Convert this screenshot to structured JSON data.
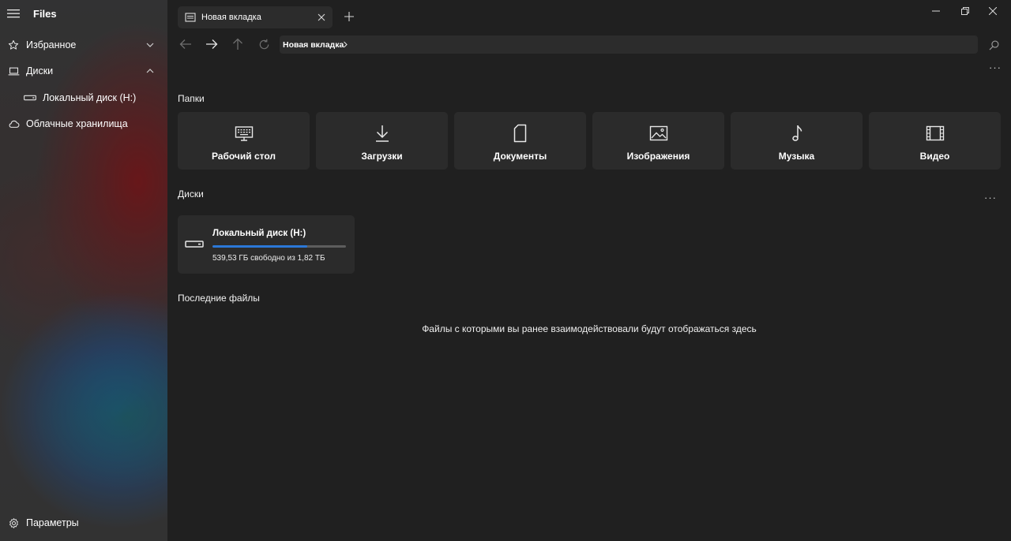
{
  "app": {
    "title": "Files"
  },
  "sidebar": {
    "favorites_label": "Избранное",
    "drives_label": "Диски",
    "local_disk_label": "Локальный диск (H:)",
    "cloud_label": "Облачные хранилища",
    "settings_label": "Параметры"
  },
  "tabs": [
    {
      "label": "Новая вкладка"
    }
  ],
  "address": {
    "crumb": "Новая вкладка"
  },
  "sections": {
    "folders": "Папки",
    "drives": "Диски",
    "recent": "Последние файлы"
  },
  "folders": [
    {
      "label": "Рабочий стол",
      "icon": "desktop-icon"
    },
    {
      "label": "Загрузки",
      "icon": "download-icon"
    },
    {
      "label": "Документы",
      "icon": "document-icon"
    },
    {
      "label": "Изображения",
      "icon": "image-icon"
    },
    {
      "label": "Музыка",
      "icon": "music-icon"
    },
    {
      "label": "Видео",
      "icon": "video-icon"
    }
  ],
  "drives": [
    {
      "name": "Локальный диск (H:)",
      "space_text": "539,53 ГБ свободно из 1,82 ТБ",
      "used_fraction": 0.71
    }
  ],
  "recent": {
    "empty_text": "Файлы с которыми вы ранее взаимодействовали будут отображаться здесь"
  },
  "colors": {
    "accent": "#2b78d7",
    "background": "#202020",
    "card": "#2b2b2b"
  }
}
